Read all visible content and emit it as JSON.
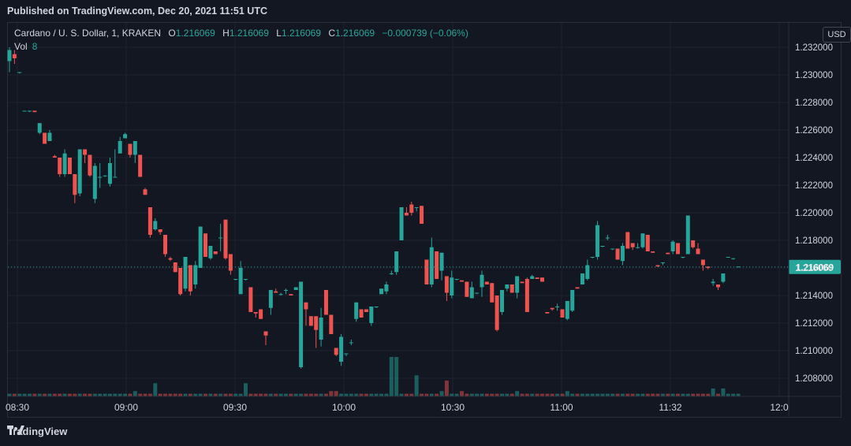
{
  "header": {
    "published": "Published on TradingView.com, Dec 20, 2021 11:51 UTC"
  },
  "legend": {
    "symbol": "Cardano / U. S. Dollar, 1, KRAKEN",
    "o_label": "O",
    "o": "1.216069",
    "h_label": "H",
    "h": "1.216069",
    "l_label": "L",
    "l": "1.216069",
    "c_label": "C",
    "c": "1.216069",
    "change": "−0.000739 (−0.06%)",
    "vol_label": "Vol",
    "vol": "8"
  },
  "currency": "USD",
  "last_price": "1.216069",
  "footer": {
    "brand": "TradingView"
  },
  "colors": {
    "up": "#26a69a",
    "down": "#ef5350",
    "background": "#131722",
    "grid": "#1f2330"
  },
  "chart_data": {
    "type": "candlestick",
    "y_ticks": [
      "1.232000",
      "1.230000",
      "1.228000",
      "1.226000",
      "1.224000",
      "1.222000",
      "1.220000",
      "1.218000",
      "1.216000",
      "1.214000",
      "1.212000",
      "1.210000",
      "1.208000"
    ],
    "ylim": [
      1.2068,
      1.2343
    ],
    "x_ticks": [
      {
        "label": "08:30",
        "t": 0
      },
      {
        "label": "09:00",
        "t": 30
      },
      {
        "label": "09:30",
        "t": 60
      },
      {
        "label": "10:00",
        "t": 90
      },
      {
        "label": "10:30",
        "t": 120
      },
      {
        "label": "11:00",
        "t": 150
      },
      {
        "label": "11:32",
        "t": 180
      },
      {
        "label": "12:0",
        "t": 210
      }
    ],
    "last_value": 1.216069,
    "candles": [
      [
        1.231,
        1.232,
        1.2302,
        1.2318
      ],
      [
        1.2315,
        1.2318,
        1.2308,
        1.2312
      ],
      [
        1.2302,
        1.2302,
        1.2301,
        1.2302
      ],
      [
        1.2274,
        1.2274,
        1.2274,
        1.2274
      ],
      [
        1.2274,
        1.2274,
        1.2273,
        1.2274
      ],
      [
        1.2274,
        1.2274,
        1.2273,
        1.2273
      ],
      [
        1.2258,
        1.2265,
        1.2257,
        1.2265
      ],
      [
        1.2258,
        1.2258,
        1.225,
        1.225
      ],
      [
        1.2252,
        1.226,
        1.2252,
        1.2258
      ],
      [
        1.2241,
        1.2242,
        1.224,
        1.224
      ],
      [
        1.224,
        1.224,
        1.2226,
        1.2228
      ],
      [
        1.2228,
        1.2246,
        1.2226,
        1.2243
      ],
      [
        1.224,
        1.224,
        1.2228,
        1.2228
      ],
      [
        1.2228,
        1.2228,
        1.2207,
        1.2213
      ],
      [
        1.2214,
        1.2246,
        1.2212,
        1.2246
      ],
      [
        1.2246,
        1.2246,
        1.2236,
        1.2242
      ],
      [
        1.2242,
        1.2242,
        1.2226,
        1.2227
      ],
      [
        1.221,
        1.2236,
        1.2207,
        1.2234
      ],
      [
        1.2226,
        1.2236,
        1.2218,
        1.2226
      ],
      [
        1.2227,
        1.2227,
        1.2226,
        1.2227
      ],
      [
        1.2221,
        1.224,
        1.2219,
        1.2236
      ],
      [
        1.2226,
        1.2246,
        1.2226,
        1.2226
      ],
      [
        1.2243,
        1.2255,
        1.2243,
        1.2252
      ],
      [
        1.2254,
        1.2258,
        1.2254,
        1.2257
      ],
      [
        1.225,
        1.225,
        1.224,
        1.2242
      ],
      [
        1.2242,
        1.2252,
        1.2236,
        1.2252
      ],
      [
        1.2242,
        1.2242,
        1.2226,
        1.2226
      ],
      [
        1.2217,
        1.2218,
        1.2213,
        1.2213
      ],
      [
        1.2204,
        1.2204,
        1.2182,
        1.2184
      ],
      [
        1.2188,
        1.2196,
        1.2187,
        1.2194
      ],
      [
        1.2188,
        1.2188,
        1.2184,
        1.2186
      ],
      [
        1.2184,
        1.2184,
        1.2168,
        1.217
      ],
      [
        1.2167,
        1.2168,
        1.2165,
        1.2166
      ],
      [
        1.2164,
        1.2164,
        1.2157,
        1.2157
      ],
      [
        1.216,
        1.216,
        1.214,
        1.2141
      ],
      [
        1.2145,
        1.2168,
        1.2143,
        1.2168
      ],
      [
        1.2162,
        1.2162,
        1.214,
        1.2143
      ],
      [
        1.2148,
        1.2165,
        1.2145,
        1.2162
      ],
      [
        1.216,
        1.219,
        1.216,
        1.219
      ],
      [
        1.2185,
        1.2185,
        1.2168,
        1.2168
      ],
      [
        1.2167,
        1.2175,
        1.2166,
        1.2176
      ],
      [
        1.2172,
        1.2172,
        1.2171,
        1.217
      ],
      [
        1.2182,
        1.2192,
        1.2172,
        1.2182
      ],
      [
        1.2195,
        1.2195,
        1.2166,
        1.2167
      ],
      [
        1.217,
        1.217,
        1.2155,
        1.2158
      ],
      [
        1.2152,
        1.2152,
        1.2151,
        1.2152
      ],
      [
        1.2141,
        1.2165,
        1.2141,
        1.216
      ],
      [
        1.2152,
        1.2152,
        1.2151,
        1.2152
      ],
      [
        1.2146,
        1.2146,
        1.2128,
        1.2128
      ],
      [
        1.2128,
        1.2128,
        1.2124,
        1.2127
      ],
      [
        1.213,
        1.213,
        1.2123,
        1.2123
      ],
      [
        1.2114,
        1.2114,
        1.2104,
        1.2111
      ],
      [
        1.2131,
        1.2144,
        1.2126,
        1.2144
      ],
      [
        1.2143,
        1.2145,
        1.2142,
        1.2142
      ],
      [
        1.2141,
        1.2142,
        1.214,
        1.2141
      ],
      [
        1.2144,
        1.2145,
        1.2141,
        1.2144
      ],
      [
        1.2141,
        1.2141,
        1.214,
        1.214
      ],
      [
        1.2144,
        1.2144,
        1.2146,
        1.2146
      ],
      [
        1.2088,
        1.215,
        1.2087,
        1.215
      ],
      [
        1.2135,
        1.2135,
        1.2118,
        1.213
      ],
      [
        1.2125,
        1.2125,
        1.2118,
        1.2118
      ],
      [
        1.2125,
        1.2125,
        1.2102,
        1.2115
      ],
      [
        1.2108,
        1.2131,
        1.2103,
        1.2124
      ],
      [
        1.2144,
        1.2144,
        1.2126,
        1.2126
      ],
      [
        1.2126,
        1.2126,
        1.2112,
        1.2112
      ],
      [
        1.2102,
        1.2102,
        1.2096,
        1.2097
      ],
      [
        1.2092,
        1.2112,
        1.2089,
        1.211
      ],
      [
        1.2098,
        1.2098,
        1.2096,
        1.2098
      ],
      [
        1.2106,
        1.2108,
        1.2104,
        1.2106
      ],
      [
        1.2123,
        1.2135,
        1.2121,
        1.2135
      ],
      [
        1.213,
        1.213,
        1.2124,
        1.2124
      ],
      [
        1.213,
        1.213,
        1.2128,
        1.2128
      ],
      [
        1.212,
        1.2132,
        1.2118,
        1.2132
      ],
      [
        1.2132,
        1.2132,
        1.2131,
        1.2132
      ],
      [
        1.2141,
        1.2145,
        1.2141,
        1.2145
      ],
      [
        1.2143,
        1.215,
        1.2141,
        1.2148
      ],
      [
        1.2156,
        1.2158,
        1.2155,
        1.2156
      ],
      [
        1.2157,
        1.2172,
        1.2155,
        1.2172
      ],
      [
        1.218,
        1.2204,
        1.218,
        1.2204
      ],
      [
        1.22,
        1.2204,
        1.2198,
        1.2198
      ],
      [
        1.2206,
        1.2208,
        1.2198,
        1.22
      ],
      [
        1.2204,
        1.2204,
        1.2201,
        1.2204
      ],
      [
        1.2205,
        1.2205,
        1.2192,
        1.2192
      ],
      [
        1.2166,
        1.2166,
        1.2148,
        1.2148
      ],
      [
        1.2148,
        1.2182,
        1.2146,
        1.2175
      ],
      [
        1.2172,
        1.2172,
        1.2152,
        1.2152
      ],
      [
        1.2158,
        1.2171,
        1.2151,
        1.2171
      ],
      [
        1.2154,
        1.2154,
        1.2136,
        1.2142
      ],
      [
        1.214,
        1.2158,
        1.2138,
        1.2153
      ],
      [
        1.2152,
        1.2152,
        1.2151,
        1.2152
      ],
      [
        1.2151,
        1.2151,
        1.215,
        1.215
      ],
      [
        1.215,
        1.215,
        1.2139,
        1.2139
      ],
      [
        1.2138,
        1.215,
        1.2138,
        1.2146
      ],
      [
        1.2142,
        1.2142,
        1.2141,
        1.2142
      ],
      [
        1.2146,
        1.2158,
        1.2139,
        1.2155
      ],
      [
        1.215,
        1.215,
        1.2148,
        1.2148
      ],
      [
        1.2149,
        1.2149,
        1.2135,
        1.2135
      ],
      [
        1.214,
        1.214,
        1.2114,
        1.2115
      ],
      [
        1.2128,
        1.2144,
        1.2126,
        1.2144
      ],
      [
        1.2145,
        1.2148,
        1.2143,
        1.2148
      ],
      [
        1.2148,
        1.2148,
        1.2142,
        1.2142
      ],
      [
        1.2142,
        1.2154,
        1.2138,
        1.2154
      ],
      [
        1.215,
        1.215,
        1.2149,
        1.2149
      ],
      [
        1.2152,
        1.2153,
        1.2128,
        1.2128
      ],
      [
        1.2152,
        1.2155,
        1.2152,
        1.2154
      ],
      [
        1.2153,
        1.2153,
        1.2152,
        1.2152
      ],
      [
        1.2153,
        1.2153,
        1.215,
        1.215
      ],
      [
        1.2128,
        1.2128,
        1.2127,
        1.2127
      ],
      [
        1.2131,
        1.2131,
        1.2129,
        1.213
      ],
      [
        1.2132,
        1.2134,
        1.2129,
        1.2132
      ],
      [
        1.213,
        1.213,
        1.2124,
        1.2124
      ],
      [
        1.2123,
        1.2136,
        1.2122,
        1.2136
      ],
      [
        1.2129,
        1.2144,
        1.2128,
        1.2144
      ],
      [
        1.2146,
        1.2146,
        1.2145,
        1.2145
      ],
      [
        1.2148,
        1.2156,
        1.2148,
        1.2156
      ],
      [
        1.2152,
        1.2166,
        1.2151,
        1.2162
      ],
      [
        1.2168,
        1.2168,
        1.2167,
        1.2168
      ],
      [
        1.2168,
        1.2194,
        1.2166,
        1.2191
      ],
      [
        1.2176,
        1.2176,
        1.2175,
        1.2176
      ],
      [
        1.2182,
        1.2184,
        1.218,
        1.2182
      ],
      [
        1.2174,
        1.2174,
        1.2173,
        1.2174
      ],
      [
        1.2174,
        1.2174,
        1.2166,
        1.2166
      ],
      [
        1.2165,
        1.2178,
        1.2162,
        1.2176
      ],
      [
        1.2186,
        1.2186,
        1.2174,
        1.2174
      ],
      [
        1.2178,
        1.2178,
        1.2173,
        1.2175
      ],
      [
        1.2175,
        1.2178,
        1.2174,
        1.2175
      ],
      [
        1.2175,
        1.2185,
        1.2174,
        1.2185
      ],
      [
        1.2184,
        1.2184,
        1.2172,
        1.2172
      ],
      [
        1.2172,
        1.2172,
        1.2171,
        1.2171
      ],
      [
        1.2162,
        1.2162,
        1.2161,
        1.2161
      ],
      [
        1.2164,
        1.2164,
        1.2162,
        1.2164
      ],
      [
        1.2171,
        1.2171,
        1.217,
        1.217
      ],
      [
        1.2172,
        1.218,
        1.217,
        1.2179
      ],
      [
        1.2178,
        1.2178,
        1.217,
        1.217
      ],
      [
        1.2168,
        1.2168,
        1.2167,
        1.2168
      ],
      [
        1.217,
        1.2198,
        1.217,
        1.2198
      ],
      [
        1.218,
        1.218,
        1.2174,
        1.2175
      ],
      [
        1.2174,
        1.2178,
        1.217,
        1.217
      ],
      [
        1.2166,
        1.2166,
        1.2158,
        1.2162
      ],
      [
        1.2161,
        1.2161,
        1.2159,
        1.216
      ],
      [
        1.2149,
        1.2152,
        1.2147,
        1.215
      ],
      [
        1.2148,
        1.2148,
        1.2144,
        1.2146
      ],
      [
        1.215,
        1.2156,
        1.2149,
        1.2156
      ],
      [
        1.2168,
        1.2168,
        1.2168,
        1.2168
      ],
      [
        1.2167,
        1.2167,
        1.2166,
        1.2167
      ],
      [
        1.2161,
        1.2161,
        1.2161,
        1.2161
      ]
    ],
    "volume": [
      1,
      1,
      1,
      1,
      1,
      1,
      1,
      1,
      1,
      1,
      1,
      1,
      1,
      1,
      1,
      1,
      1,
      1,
      1,
      1,
      1,
      1,
      1,
      1,
      1,
      2,
      1,
      1,
      1,
      5,
      1,
      1,
      1,
      1,
      1,
      1,
      1,
      1,
      1,
      1,
      1,
      1,
      1,
      1,
      1,
      1,
      1,
      5,
      1,
      1,
      1,
      1,
      1,
      1,
      1,
      1,
      1,
      1,
      1,
      1,
      1,
      1,
      1,
      1,
      2,
      2,
      1,
      1,
      1,
      1,
      1,
      1,
      1,
      1,
      1,
      1,
      15,
      15,
      1,
      1,
      1,
      8,
      1,
      1,
      1,
      1,
      2,
      6,
      1,
      1,
      2,
      1,
      1,
      1,
      1,
      1,
      1,
      1,
      1,
      1,
      1,
      2,
      1,
      1,
      1,
      1,
      1,
      1,
      1,
      1,
      1,
      2,
      1,
      1,
      1,
      1,
      1,
      1,
      1,
      1,
      1,
      1,
      1,
      1,
      1,
      1,
      1,
      1,
      1,
      1,
      1,
      1,
      1,
      1,
      1,
      1,
      1,
      1,
      1,
      1,
      3,
      1,
      3,
      1,
      1,
      1,
      1,
      1,
      1,
      1,
      1,
      1,
      1,
      1,
      1,
      1,
      1,
      1,
      1,
      1,
      1,
      1,
      1,
      1,
      1,
      1,
      1,
      1,
      1,
      1,
      1,
      1,
      3,
      1,
      1,
      1,
      1,
      1,
      1,
      1,
      1,
      1,
      1,
      1,
      1,
      1,
      1,
      1,
      1,
      1,
      1,
      1,
      1,
      1,
      1,
      1,
      1,
      1,
      1,
      1,
      1,
      1,
      1,
      1,
      1,
      1,
      1,
      1,
      1,
      1,
      1,
      1,
      4,
      1,
      1,
      1,
      1,
      1,
      1,
      1
    ]
  }
}
